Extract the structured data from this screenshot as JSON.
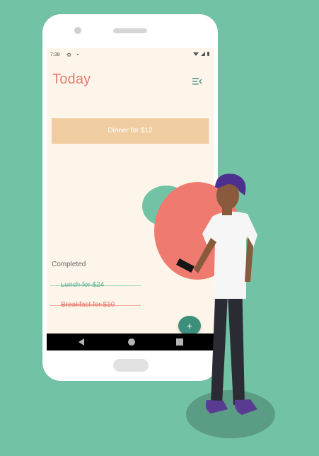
{
  "status_bar": {
    "time": "7:38"
  },
  "app": {
    "title": "Today"
  },
  "tasks": {
    "pending": [
      "Dinner for $12"
    ],
    "completed_heading": "Completed",
    "completed": [
      "Lunch for $24",
      "Breakfast for $10"
    ]
  },
  "fab": {
    "label": "+"
  },
  "icons": {
    "settings": "gear-icon",
    "menu": "sort-menu-icon",
    "back": "back-icon",
    "home": "home-icon",
    "recents": "recents-icon"
  },
  "colors": {
    "background": "#72c3a6",
    "screen": "#fef5ea",
    "accent": "#ea7b6f",
    "pending_card": "#f0cda0",
    "fab": "#3c8f7d"
  }
}
